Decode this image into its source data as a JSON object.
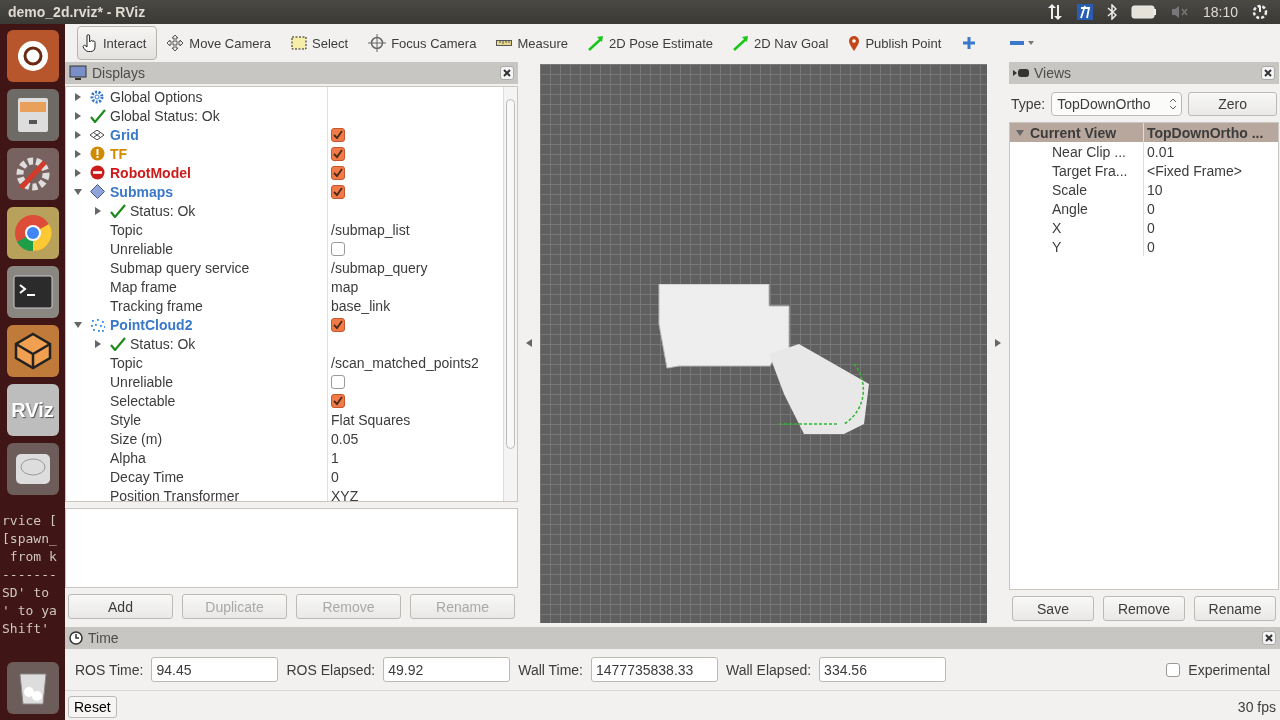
{
  "window": {
    "title": "demo_2d.rviz* - RViz"
  },
  "top_bar": {
    "clock": "18:10"
  },
  "launcher": {
    "logo_text": "RViz",
    "terminal_lines": [
      "rvice [",
      "[spawn_",
      " from k",
      "-------",
      "SD' to",
      "' to ya",
      "Shift'"
    ]
  },
  "toolbar": {
    "tools": [
      {
        "label": "Interact",
        "kind": "interact",
        "selected": true
      },
      {
        "label": "Move Camera",
        "kind": "move",
        "selected": false
      },
      {
        "label": "Select",
        "kind": "select",
        "selected": false
      },
      {
        "label": "Focus Camera",
        "kind": "focus",
        "selected": false
      },
      {
        "label": "Measure",
        "kind": "measure",
        "selected": false
      },
      {
        "label": "2D Pose Estimate",
        "kind": "arrow",
        "selected": false
      },
      {
        "label": "2D Nav Goal",
        "kind": "arrow",
        "selected": false
      },
      {
        "label": "Publish Point",
        "kind": "pin",
        "selected": false
      }
    ]
  },
  "displays": {
    "title": "Displays",
    "rows": [
      {
        "label": "Global Options",
        "kind": "options",
        "expanded": false
      },
      {
        "label": "Global Status: Ok",
        "kind": "status",
        "expanded": false
      },
      {
        "label": "Grid",
        "kind": "grid",
        "color": "#3a78c9",
        "checked": true,
        "expanded": false
      },
      {
        "label": "TF",
        "kind": "warning",
        "color": "#d08a00",
        "checked": true,
        "expanded": false
      },
      {
        "label": "RobotModel",
        "kind": "error",
        "color": "#cc1b1b",
        "checked": true,
        "expanded": false
      },
      {
        "label": "Submaps",
        "kind": "submaps",
        "color": "#3a78c9",
        "checked": true,
        "expanded": true,
        "children": [
          {
            "label": "Status: Ok",
            "kind": "status",
            "expanded": false
          },
          {
            "label": "Topic",
            "kind": "text",
            "value": "/submap_list"
          },
          {
            "label": "Unreliable",
            "kind": "check",
            "checked": false
          },
          {
            "label": "Submap query service",
            "kind": "text",
            "value": "/submap_query"
          },
          {
            "label": "Map frame",
            "kind": "text",
            "value": "map"
          },
          {
            "label": "Tracking frame",
            "kind": "text",
            "value": "base_link"
          }
        ]
      },
      {
        "label": "PointCloud2",
        "kind": "pointcloud",
        "color": "#3a78c9",
        "checked": true,
        "expanded": true,
        "children": [
          {
            "label": "Status: Ok",
            "kind": "status",
            "expanded": false
          },
          {
            "label": "Topic",
            "kind": "text",
            "value": "/scan_matched_points2"
          },
          {
            "label": "Unreliable",
            "kind": "check",
            "checked": false
          },
          {
            "label": "Selectable",
            "kind": "check",
            "checked": true
          },
          {
            "label": "Style",
            "kind": "text",
            "value": "Flat Squares"
          },
          {
            "label": "Size (m)",
            "kind": "text",
            "value": "0.05"
          },
          {
            "label": "Alpha",
            "kind": "text",
            "value": "1"
          },
          {
            "label": "Decay Time",
            "kind": "text",
            "value": "0"
          },
          {
            "label": "Position Transformer",
            "kind": "text",
            "value": "XYZ"
          }
        ]
      }
    ],
    "buttons": [
      {
        "label": "Add",
        "disabled": false
      },
      {
        "label": "Duplicate",
        "disabled": true
      },
      {
        "label": "Remove",
        "disabled": true
      },
      {
        "label": "Rename",
        "disabled": true
      }
    ]
  },
  "views": {
    "title": "Views",
    "type_label": "Type:",
    "type_value": "TopDownOrtho",
    "zero_button": "Zero",
    "header": {
      "label": "Current View",
      "value": "TopDownOrtho ...",
      "expanded": true
    },
    "properties": [
      {
        "label": "Near Clip ...",
        "value": "0.01"
      },
      {
        "label": "Target Fra...",
        "value": "<Fixed Frame>"
      },
      {
        "label": "Scale",
        "value": "10"
      },
      {
        "label": "Angle",
        "value": "0"
      },
      {
        "label": "X",
        "value": "0"
      },
      {
        "label": "Y",
        "value": "0"
      }
    ],
    "buttons": [
      "Save",
      "Remove",
      "Rename"
    ]
  },
  "time": {
    "title": "Time",
    "fields": [
      {
        "label": "ROS Time:",
        "value": "94.45"
      },
      {
        "label": "ROS Elapsed:",
        "value": "49.92"
      },
      {
        "label": "Wall Time:",
        "value": "1477735838.33"
      },
      {
        "label": "Wall Elapsed:",
        "value": "334.56"
      }
    ],
    "experimental": {
      "label": "Experimental",
      "checked": false
    },
    "reset_button": "Reset",
    "fps": "30 fps"
  }
}
